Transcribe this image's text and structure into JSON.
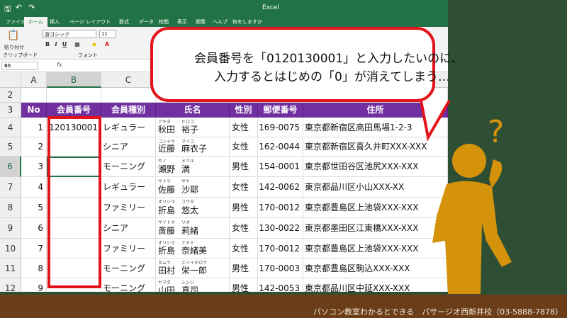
{
  "window": {
    "title": "Excel"
  },
  "tabs": [
    "ファイル",
    "ホーム",
    "挿入",
    "ページ レイアウト",
    "数式",
    "データ",
    "校閲",
    "表示",
    "開発",
    "ヘルプ",
    "何をしますか"
  ],
  "active_tab": "ホーム",
  "ribbon": {
    "font_name": "游ゴシック",
    "font_size": "11",
    "clipboard_group": "クリップボード",
    "font_group": "フォント",
    "paste_label": "貼り付け"
  },
  "formula_bar": {
    "name_box": "B6",
    "fx": "fx"
  },
  "columns": [
    "A",
    "B",
    "C"
  ],
  "rows": [
    "2",
    "3",
    "4",
    "5",
    "6",
    "7",
    "8",
    "9",
    "10",
    "11",
    "12"
  ],
  "table": {
    "headers": [
      "No",
      "会員番号",
      "会員種別",
      "氏名",
      "性別",
      "郵便番号",
      "住所"
    ],
    "records": [
      {
        "no": "1",
        "id": "120130001",
        "type": "レギュラー",
        "furi_last": "アキタ",
        "furi_first": "ヒロコ",
        "last": "秋田",
        "first": "裕子",
        "sex": "女性",
        "zip": "169-0075",
        "addr": "東京都新宿区高田馬場1-2-3"
      },
      {
        "no": "2",
        "id": "",
        "type": "シニア",
        "furi_last": "コンドウ",
        "furi_first": "マイコ",
        "last": "近藤",
        "first": "麻衣子",
        "sex": "女性",
        "zip": "162-0044",
        "addr": "東京都新宿区喜久井町XXX-XXX"
      },
      {
        "no": "3",
        "id": "",
        "type": "モーニング",
        "furi_last": "セノ",
        "furi_first": "ミツル",
        "last": "瀬野",
        "first": "満",
        "sex": "男性",
        "zip": "154-0001",
        "addr": "東京都世田谷区池尻XXX-XXX"
      },
      {
        "no": "4",
        "id": "",
        "type": "レギュラー",
        "furi_last": "サトウ",
        "furi_first": "サヤ",
        "last": "佐藤",
        "first": "沙耶",
        "sex": "女性",
        "zip": "142-0062",
        "addr": "東京都品川区小山XXX-XX"
      },
      {
        "no": "5",
        "id": "",
        "type": "ファミリー",
        "furi_last": "オリシマ",
        "furi_first": "ユウタ",
        "last": "折島",
        "first": "悠太",
        "sex": "男性",
        "zip": "170-0012",
        "addr": "東京都豊島区上池袋XXX-XXX"
      },
      {
        "no": "6",
        "id": "",
        "type": "シニア",
        "furi_last": "サイトウ",
        "furi_first": "リオ",
        "last": "斎藤",
        "first": "莉緒",
        "sex": "女性",
        "zip": "130-0022",
        "addr": "東京都墨田区江東橋XXX-XXX"
      },
      {
        "no": "7",
        "id": "",
        "type": "ファミリー",
        "furi_last": "オリシマ",
        "furi_first": "ナオミ",
        "last": "折島",
        "first": "奈緒美",
        "sex": "女性",
        "zip": "170-0012",
        "addr": "東京都豊島区上池袋XXX-XXX"
      },
      {
        "no": "8",
        "id": "",
        "type": "モーニング",
        "furi_last": "タムラ",
        "furi_first": "エイイチロウ",
        "last": "田村",
        "first": "栄一郎",
        "sex": "男性",
        "zip": "170-0003",
        "addr": "東京都豊島区駒込XXX-XXX"
      },
      {
        "no": "9",
        "id": "",
        "type": "モーニング",
        "furi_last": "ヤマダ",
        "furi_first": "シンジ",
        "last": "山田",
        "first": "真司",
        "sex": "男性",
        "zip": "142-0053",
        "addr": "東京都品川区中延XXX-XXX"
      }
    ]
  },
  "bubble": {
    "line1": "会員番号を「0120130001」と入力したいのに、",
    "line2": "入力するとはじめの「0」が消えてしまう…"
  },
  "question_mark": "?",
  "footer": "パソコン教室わかるとできる　パサージオ西新井校（03-5888-7878）",
  "colors": {
    "excel_green": "#217346",
    "header_purple": "#7030a0",
    "alert_red": "#e3131b",
    "person": "#d4930a"
  }
}
